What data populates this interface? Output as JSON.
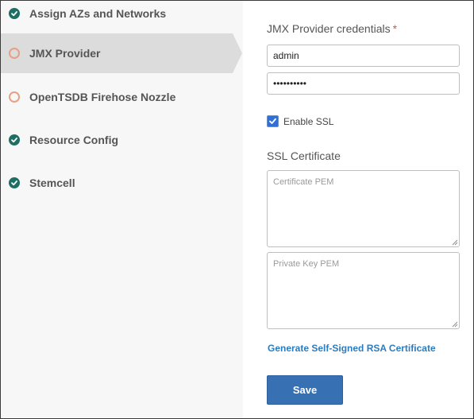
{
  "sidebar": {
    "items": [
      {
        "label": "Assign AZs and Networks",
        "status": "complete",
        "icon": "check-circle-icon"
      },
      {
        "label": "JMX Provider",
        "status": "incomplete",
        "icon": "ring-icon"
      },
      {
        "label": "OpenTSDB Firehose Nozzle",
        "status": "incomplete",
        "icon": "ring-icon"
      },
      {
        "label": "Resource Config",
        "status": "complete",
        "icon": "check-circle-icon"
      },
      {
        "label": "Stemcell",
        "status": "complete",
        "icon": "check-circle-icon"
      }
    ],
    "active_item": "JMX Provider"
  },
  "form": {
    "credentials_label": "JMX Provider credentials",
    "required_marker": "*",
    "username_value": "admin",
    "password_value": "••••••••••",
    "enable_ssl_label": "Enable SSL",
    "enable_ssl_checked": true,
    "ssl_certificate_label": "SSL Certificate",
    "certificate_placeholder": "Certificate PEM",
    "private_key_placeholder": "Private Key PEM",
    "generate_link": "Generate Self-Signed RSA Certificate",
    "save_label": "Save"
  },
  "colors": {
    "complete": "#1f6e63",
    "incomplete": "#e6a083",
    "primary_button": "#3870b4",
    "link": "#2b7bbf",
    "required": "#d9534f"
  }
}
